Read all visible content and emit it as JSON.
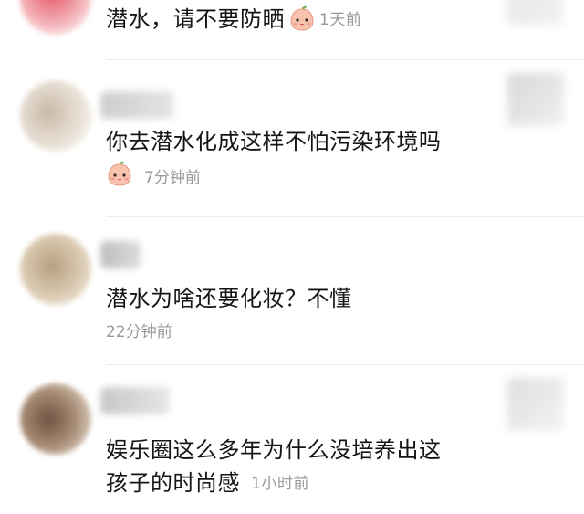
{
  "comments": [
    {
      "text": "潜水，请不要防晒",
      "has_emoji": true,
      "emoji": "peach-face-emoji",
      "time": "1天前"
    },
    {
      "text": "你去潜水化成这样不怕污染环境吗",
      "has_emoji": true,
      "emoji": "peach-face-emoji",
      "time": "7分钟前"
    },
    {
      "text": "潜水为啥还要化妆？不懂",
      "has_emoji": false,
      "time": "22分钟前"
    },
    {
      "text_line1": "娱乐圈这么多年为什么没培养出这",
      "text_line2": "孩子的时尚感",
      "has_emoji": false,
      "time": "1小时前"
    }
  ],
  "colors": {
    "text": "#151515",
    "meta": "#9a9a9a",
    "divider": "#ececec",
    "emoji_face": "#f7b9a4",
    "emoji_leaf": "#6cae4f"
  }
}
